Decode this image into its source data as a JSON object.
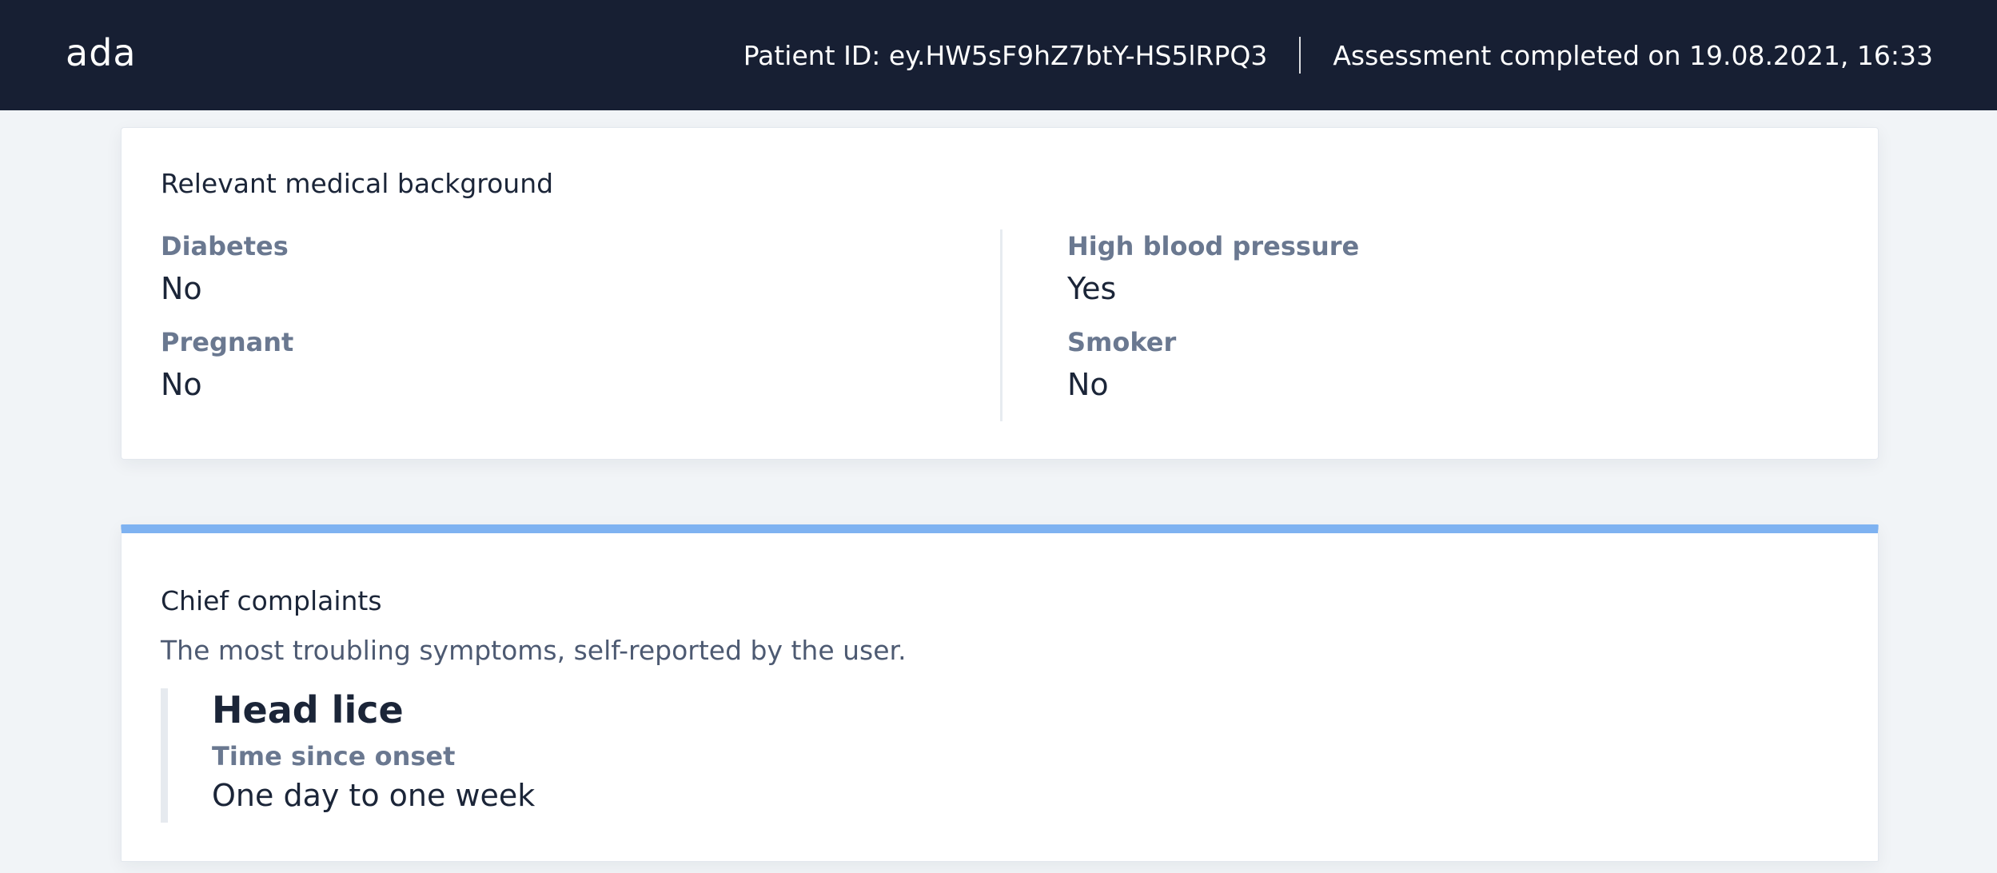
{
  "header": {
    "logo_text": "ada",
    "patient_id": "Patient ID: ey.HW5sF9hZ7btY-HS5lRPQ3",
    "assessment_completed": "Assessment completed on 19.08.2021, 16:33"
  },
  "medical_background": {
    "title": "Relevant medical background",
    "fields": [
      {
        "label": "Diabetes",
        "value": "No"
      },
      {
        "label": "Pregnant",
        "value": "No"
      },
      {
        "label": "High blood pressure",
        "value": "Yes"
      },
      {
        "label": "Smoker",
        "value": "No"
      }
    ]
  },
  "chief_complaints": {
    "title": "Chief complaints",
    "subtitle": "The most troubling symptoms, self-reported by the user.",
    "items": [
      {
        "name": "Head lice",
        "detail_label": "Time since onset",
        "detail_value": "One day to one week"
      }
    ]
  },
  "colors": {
    "header_bg": "#171f33",
    "page_bg": "#f1f4f7",
    "accent_bar": "#7eb2f1",
    "label_color": "#6a7890"
  }
}
